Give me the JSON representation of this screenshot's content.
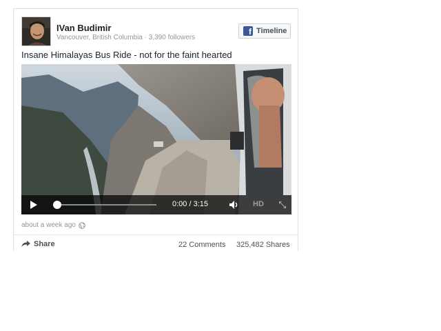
{
  "post": {
    "author": {
      "name": "IVan Budimir",
      "meta": "Vancouver, British Columbia · 3,390 followers"
    },
    "timeline_button": {
      "label": "Timeline",
      "icon": "facebook-icon"
    },
    "title": "Insane Himalayas Bus Ride - not for the faint hearted",
    "video": {
      "time": "0:00 / 3:15",
      "progress": 0,
      "hd_label": "HD",
      "icons": [
        "play-icon",
        "volume-icon",
        "fullscreen-icon"
      ]
    },
    "timestamp": "about a week ago",
    "footer": {
      "share_label": "Share",
      "comments": "22 Comments",
      "shares": "325,482 Shares"
    }
  },
  "colors": {
    "brand": "#3b5998",
    "muted_text": "#90949c",
    "border": "#dddfe2"
  }
}
